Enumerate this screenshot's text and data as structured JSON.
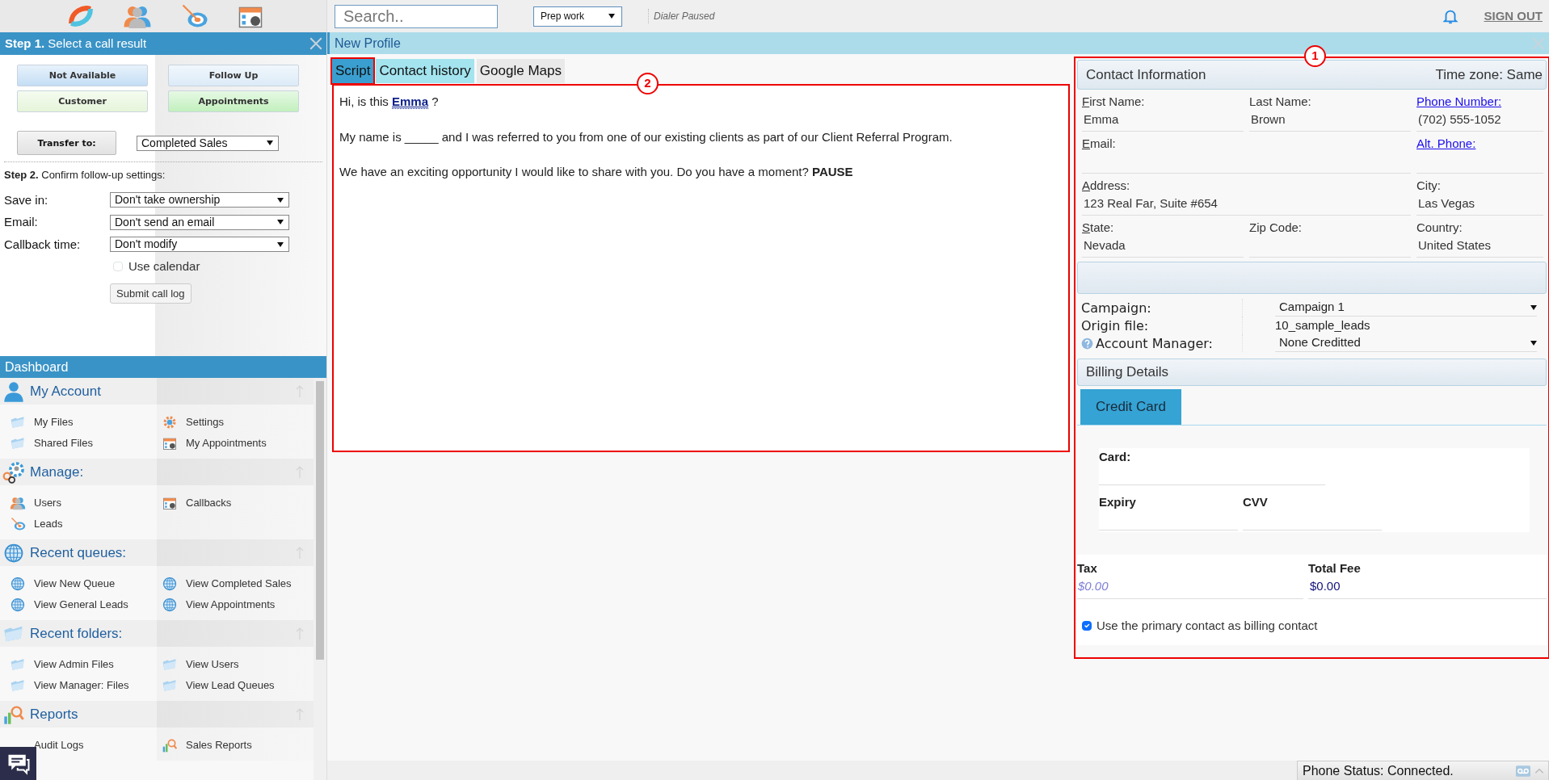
{
  "top_bar": {
    "search": {
      "placeholder": "Search.."
    },
    "mode_select": {
      "value": "Prep work"
    },
    "dialer_status": "Dialer Paused",
    "sign_out": "SIGN OUT"
  },
  "step1": {
    "title": "**Step 1.** Select a call result",
    "results": [
      {
        "label": "Not Available",
        "color": "#c5def5"
      },
      {
        "label": "Follow Up",
        "color": "#dcebf8"
      },
      {
        "label": "Customer",
        "color": "#e6f5da"
      },
      {
        "label": "Appointments",
        "color": "#c2f0bd"
      }
    ],
    "transfer": {
      "button": "Transfer to:",
      "value": "Completed Sales"
    }
  },
  "step2": {
    "title": "**Step 2.** Confirm follow-up settings:",
    "settings": [
      {
        "label": "Save in:",
        "value": "Don't take ownership"
      },
      {
        "label": "Email:",
        "value": "Don't send an email"
      },
      {
        "label": "Callback time:",
        "value": "Don't modify"
      }
    ],
    "use_calendar": {
      "label": "Use calendar",
      "checked": false
    },
    "submit": "Submit call log"
  },
  "dashboard": {
    "title": "Dashboard",
    "sections": [
      {
        "title": "My Account",
        "kind": "account",
        "items": [
          {
            "label": "My Files",
            "kind": "file"
          },
          {
            "label": "Settings",
            "kind": "setting"
          },
          {
            "label": "Shared Files",
            "kind": "file"
          },
          {
            "label": "My Appointments",
            "kind": "appointment"
          }
        ]
      },
      {
        "title": "Manage:",
        "kind": "manage",
        "items": [
          {
            "label": "Users",
            "kind": "user"
          },
          {
            "label": "Callbacks",
            "kind": "callback"
          },
          {
            "label": "Leads",
            "kind": "lead"
          }
        ]
      },
      {
        "title": "Recent queues:",
        "kind": "queues",
        "items": [
          {
            "label": "View New Queue",
            "kind": "queue"
          },
          {
            "label": "View Completed Sales",
            "kind": "queue"
          },
          {
            "label": "View General Leads",
            "kind": "queue"
          },
          {
            "label": "View Appointments",
            "kind": "queue"
          }
        ]
      },
      {
        "title": "Recent folders:",
        "kind": "folders",
        "items": [
          {
            "label": "View Admin Files",
            "kind": "folder"
          },
          {
            "label": "View Users",
            "kind": "folder"
          },
          {
            "label": "View Manager: Files",
            "kind": "folder"
          },
          {
            "label": "View Lead Queues",
            "kind": "folder"
          }
        ]
      },
      {
        "title": "Reports",
        "kind": "reports",
        "items": [
          {
            "label": "Audit Logs",
            "kind": "report"
          },
          {
            "label": "Sales Reports",
            "kind": "report"
          }
        ]
      }
    ]
  },
  "profile": {
    "title": "New Profile"
  },
  "tabs": [
    {
      "label": "Script",
      "selected": true,
      "highlighted": false
    },
    {
      "label": "Contact history",
      "selected": false,
      "highlighted": true
    },
    {
      "label": "Google Maps",
      "selected": false,
      "highlighted": false
    }
  ],
  "script": {
    "callout": "2",
    "greeting": {
      "before": "Hi, is this",
      "name": "Emma",
      "after": "?"
    },
    "paragraphs": [
      "My name is _____ and I was referred to you from one of our existing clients as part of our Client Referral Program.",
      "We have an exciting opportunity I would like to share with you. Do you have a moment? **PAUSE**"
    ]
  },
  "contact": {
    "callout": "1",
    "title": "Contact Information",
    "timezone": "Time zone: Same",
    "rows": [
      [
        {
          "label": "First Name:",
          "value": "Emma",
          "link": false,
          "access_key": true
        },
        {
          "label": "Last Name:",
          "value": "Brown",
          "link": false,
          "access_key": false
        },
        {
          "label": "Phone Number:",
          "value": "(702) 555-1052",
          "link": true,
          "access_key": false
        }
      ],
      [
        {
          "label": "Email:",
          "link": false,
          "access_key": true
        },
        {
          "label": "Alt. Phone:",
          "link": true,
          "access_key": false
        }
      ],
      [
        {
          "label": "Address:",
          "value": "123 Real Far, Suite #654",
          "link": false,
          "access_key": true
        },
        {
          "label": "City:",
          "value": "Las Vegas",
          "link": false,
          "access_key": false
        }
      ],
      [
        {
          "label": "State:",
          "value": "Nevada",
          "link": false,
          "access_key": true
        },
        {
          "label": "Zip Code:",
          "link": false,
          "access_key": false
        },
        {
          "label": "Country:",
          "value": "United States",
          "link": false,
          "access_key": false
        }
      ]
    ],
    "campaign_rows": [
      {
        "label": "Campaign:",
        "value": "Campaign 1",
        "kind": "select",
        "help": false
      },
      {
        "label": "Origin file:",
        "value": "10_sample_leads",
        "kind": "text",
        "help": false
      },
      {
        "label": "Account Manager:",
        "value": "None Creditted",
        "kind": "select",
        "help": true
      }
    ]
  },
  "billing": {
    "title": "Billing Details",
    "tabs": [
      {
        "label": "Credit Card",
        "selected": true
      }
    ],
    "card": {
      "label": "Card:"
    },
    "expiry": {
      "label": "Expiry"
    },
    "cvv": {
      "label": "CVV"
    },
    "tax": {
      "label": "Tax",
      "value": "$0.00"
    },
    "total": {
      "label": "Total Fee",
      "value": "$0.00"
    },
    "use_primary": {
      "label": "Use the primary contact as billing contact",
      "checked": true
    }
  },
  "status_bar": {
    "phone_status": "Phone Status: Connected."
  }
}
